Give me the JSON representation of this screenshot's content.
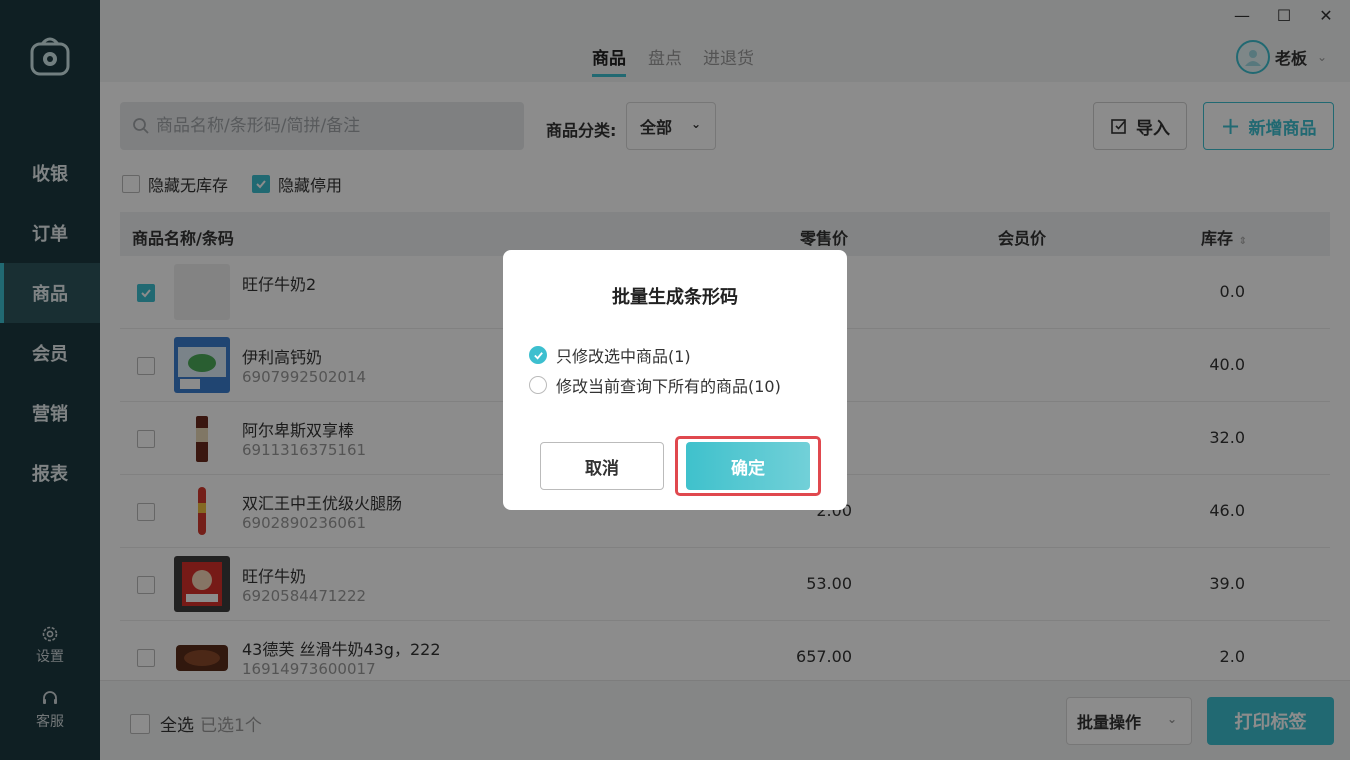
{
  "sidebar": {
    "items": [
      {
        "label": "收银",
        "active": false
      },
      {
        "label": "订单",
        "active": false
      },
      {
        "label": "商品",
        "active": true
      },
      {
        "label": "会员",
        "active": false
      },
      {
        "label": "营销",
        "active": false
      },
      {
        "label": "报表",
        "active": false
      }
    ],
    "settings_label": "设置",
    "service_label": "客服"
  },
  "header": {
    "tabs": [
      {
        "label": "商品",
        "active": true
      },
      {
        "label": "盘点",
        "active": false
      },
      {
        "label": "进退货",
        "active": false
      }
    ],
    "user_name": "老板",
    "window_controls": {
      "minimize": "—",
      "maximize": "☐",
      "close": "✕"
    }
  },
  "toolbar": {
    "search_placeholder": "商品名称/条形码/简拼/备注",
    "category_label": "商品分类:",
    "category_value": "全部",
    "import_label": "导入",
    "add_label": "新增商品"
  },
  "filters": {
    "hide_no_stock": {
      "label": "隐藏无库存",
      "checked": false
    },
    "hide_disabled": {
      "label": "隐藏停用",
      "checked": true
    }
  },
  "table": {
    "headers": {
      "name": "商品名称/条码",
      "retail_price": "零售价",
      "member_price": "会员价",
      "stock": "库存"
    },
    "rows": [
      {
        "name": "旺仔牛奶2",
        "code": "",
        "price": "",
        "stock": "0.0",
        "checked": true
      },
      {
        "name": "伊利高钙奶",
        "code": "6907992502014",
        "price": "",
        "stock": "40.0",
        "checked": false
      },
      {
        "name": "阿尔卑斯双享棒",
        "code": "6911316375161",
        "price": "",
        "stock": "32.0",
        "checked": false
      },
      {
        "name": "双汇王中王优级火腿肠",
        "code": "6902890236061",
        "price": "2.00",
        "stock": "46.0",
        "checked": false
      },
      {
        "name": "旺仔牛奶",
        "code": "6920584471222",
        "price": "53.00",
        "stock": "39.0",
        "checked": false
      },
      {
        "name": "43德芙 丝滑牛奶43g，222",
        "code": "16914973600017",
        "price": "657.00",
        "stock": "2.0",
        "checked": false
      }
    ]
  },
  "footer": {
    "select_all_label": "全选",
    "selected_text": "已选1个",
    "bulk_label": "批量操作",
    "print_label": "打印标签"
  },
  "modal": {
    "title": "批量生成条形码",
    "options": [
      {
        "label": "只修改选中商品(1)",
        "selected": true
      },
      {
        "label": "修改当前查询下所有的商品(10)",
        "selected": false
      }
    ],
    "cancel_label": "取消",
    "confirm_label": "确定"
  },
  "colors": {
    "accent": "#3dbfcf",
    "sidebar": "#1d3a40",
    "highlight": "#e0484e"
  }
}
